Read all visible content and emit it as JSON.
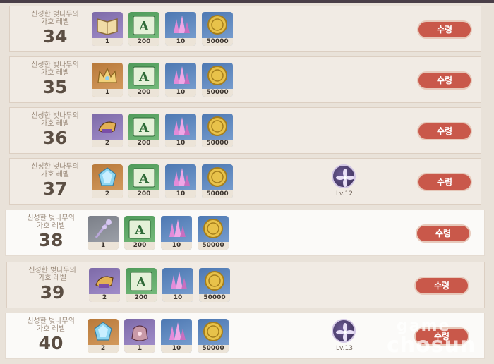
{
  "title_text": "신성한 벚나무의\n가호 레벨",
  "claim_label": "수령",
  "rows": [
    {
      "level": "34",
      "rewards": [
        {
          "icon": "book-icon",
          "bg": "purple",
          "qty": "1"
        },
        {
          "icon": "exp-ticket-icon",
          "bg": "green",
          "qty": "200"
        },
        {
          "icon": "crystal-icon",
          "bg": "blue",
          "qty": "10"
        },
        {
          "icon": "mora-coin-icon",
          "bg": "blue",
          "qty": "50000"
        }
      ],
      "badge": null
    },
    {
      "level": "35",
      "rewards": [
        {
          "icon": "crown-icon",
          "bg": "orange",
          "qty": "1"
        },
        {
          "icon": "exp-ticket-icon",
          "bg": "green",
          "qty": "200"
        },
        {
          "icon": "crystal-icon",
          "bg": "blue",
          "qty": "10"
        },
        {
          "icon": "mora-coin-icon",
          "bg": "blue",
          "qty": "50000"
        }
      ],
      "badge": null
    },
    {
      "level": "36",
      "rewards": [
        {
          "icon": "gauntlet-icon",
          "bg": "purple",
          "qty": "2"
        },
        {
          "icon": "exp-ticket-icon",
          "bg": "green",
          "qty": "200"
        },
        {
          "icon": "crystal-icon",
          "bg": "blue",
          "qty": "10"
        },
        {
          "icon": "mora-coin-icon",
          "bg": "blue",
          "qty": "50000"
        }
      ],
      "badge": null
    },
    {
      "level": "37",
      "rewards": [
        {
          "icon": "gem-icon",
          "bg": "orange",
          "qty": "2"
        },
        {
          "icon": "exp-ticket-icon",
          "bg": "green",
          "qty": "200"
        },
        {
          "icon": "crystal-icon",
          "bg": "blue",
          "qty": "10"
        },
        {
          "icon": "mora-coin-icon",
          "bg": "blue",
          "qty": "50000"
        }
      ],
      "badge": {
        "icon": "sakura-emblem-icon",
        "label": "Lv.12"
      }
    },
    {
      "level": "38",
      "rewards": [
        {
          "icon": "branch-icon",
          "bg": "gray",
          "qty": "1"
        },
        {
          "icon": "exp-ticket-icon",
          "bg": "green",
          "qty": "200"
        },
        {
          "icon": "crystal-icon",
          "bg": "blue",
          "qty": "10"
        },
        {
          "icon": "mora-coin-icon",
          "bg": "blue",
          "qty": "50000"
        }
      ],
      "badge": null
    },
    {
      "level": "39",
      "rewards": [
        {
          "icon": "gauntlet-icon",
          "bg": "purple",
          "qty": "2"
        },
        {
          "icon": "exp-ticket-icon",
          "bg": "green",
          "qty": "200"
        },
        {
          "icon": "crystal-icon",
          "bg": "blue",
          "qty": "10"
        },
        {
          "icon": "mora-coin-icon",
          "bg": "blue",
          "qty": "50000"
        }
      ],
      "badge": null
    },
    {
      "level": "40",
      "rewards": [
        {
          "icon": "gem-icon",
          "bg": "orange",
          "qty": "2"
        },
        {
          "icon": "pouch-icon",
          "bg": "purple",
          "qty": "1"
        },
        {
          "icon": "crystal-icon",
          "bg": "blue",
          "qty": "10"
        },
        {
          "icon": "mora-coin-icon",
          "bg": "blue",
          "qty": "50000"
        }
      ],
      "badge": {
        "icon": "sakura-emblem-icon",
        "label": "Lv.13"
      }
    }
  ],
  "watermark": {
    "line1": "game",
    "line2": "chosun"
  },
  "colors": {
    "claim_button": "#c9584a",
    "row_bg": "#f1ebe4",
    "page_bg": "#e9e2d9"
  }
}
